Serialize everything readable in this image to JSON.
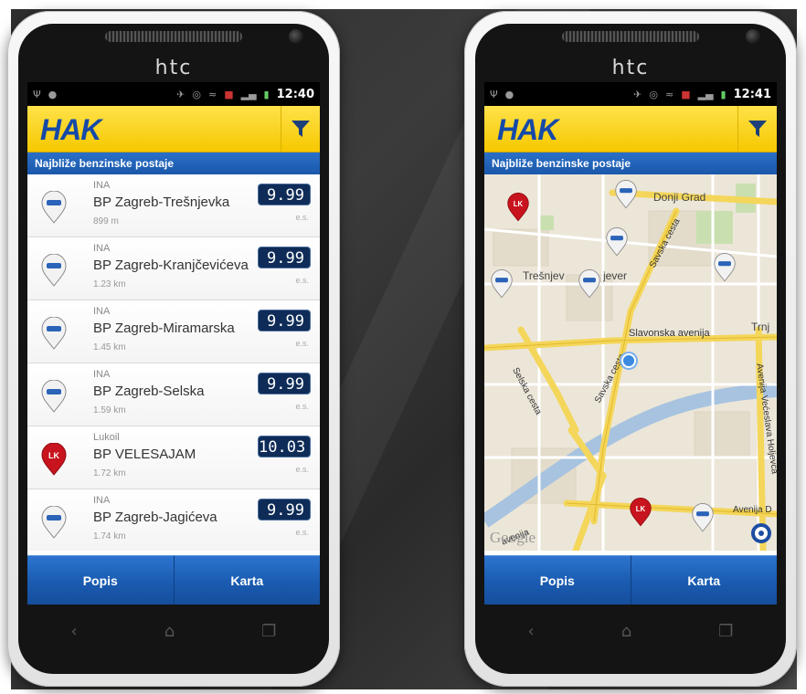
{
  "device": {
    "brand": "htc"
  },
  "left_phone": {
    "status_time": "12:40",
    "app_logo": "HAK",
    "section_title": "Najbliže benzinske postaje",
    "stations": [
      {
        "brand": "INA",
        "name": "BP Zagreb-Trešnjevka",
        "distance": "899 m",
        "price": "9.99",
        "fuel": "e.s.",
        "pin": "ina"
      },
      {
        "brand": "INA",
        "name": "BP Zagreb-Kranjčevićeva",
        "distance": "1.23 km",
        "price": "9.99",
        "fuel": "e.s.",
        "pin": "ina"
      },
      {
        "brand": "INA",
        "name": "BP Zagreb-Miramarska",
        "distance": "1.45 km",
        "price": "9.99",
        "fuel": "e.s.",
        "pin": "ina"
      },
      {
        "brand": "INA",
        "name": "BP Zagreb-Selska",
        "distance": "1.59 km",
        "price": "9.99",
        "fuel": "e.s.",
        "pin": "ina"
      },
      {
        "brand": "Lukoil",
        "name": "BP VELESAJAM",
        "distance": "1.72 km",
        "price": "10.03",
        "fuel": "e.s.",
        "pin": "lukoil"
      },
      {
        "brand": "INA",
        "name": "BP Zagreb-Jagićeva",
        "distance": "1.74 km",
        "price": "9.99",
        "fuel": "e.s.",
        "pin": "ina"
      }
    ],
    "tabs": {
      "list": "Popis",
      "map": "Karta"
    }
  },
  "right_phone": {
    "status_time": "12:41",
    "app_logo": "HAK",
    "section_title": "Najbliže benzinske postaje",
    "map_labels": {
      "district_1": "Donji Grad",
      "district_2": "Trešnjev",
      "district_2b": "jever",
      "district_3": "Trnj",
      "road_1": "Savska cesta",
      "road_2": "Slavonska avenija",
      "road_3": "Savska cesta",
      "road_4": "Selska cesta",
      "road_5": "Avenija Većeslava Holjevca",
      "road_6": "Avenija D",
      "road_7": "avenija",
      "attribution": "Google"
    },
    "tabs": {
      "list": "Popis",
      "map": "Karta"
    }
  },
  "colors": {
    "appbar_yellow": "#f6c800",
    "logo_blue": "#1549a8",
    "header_blue": "#1a58aa",
    "price_navy": "#0e2c57",
    "lukoil_red": "#c8141e"
  },
  "icons": {
    "filter": "funnel-icon",
    "ina_pin": "ina-pin-icon",
    "lukoil_pin": "lukoil-pin-icon",
    "nav_back": "back-icon",
    "nav_home": "home-icon",
    "nav_recent": "recent-apps-icon"
  }
}
